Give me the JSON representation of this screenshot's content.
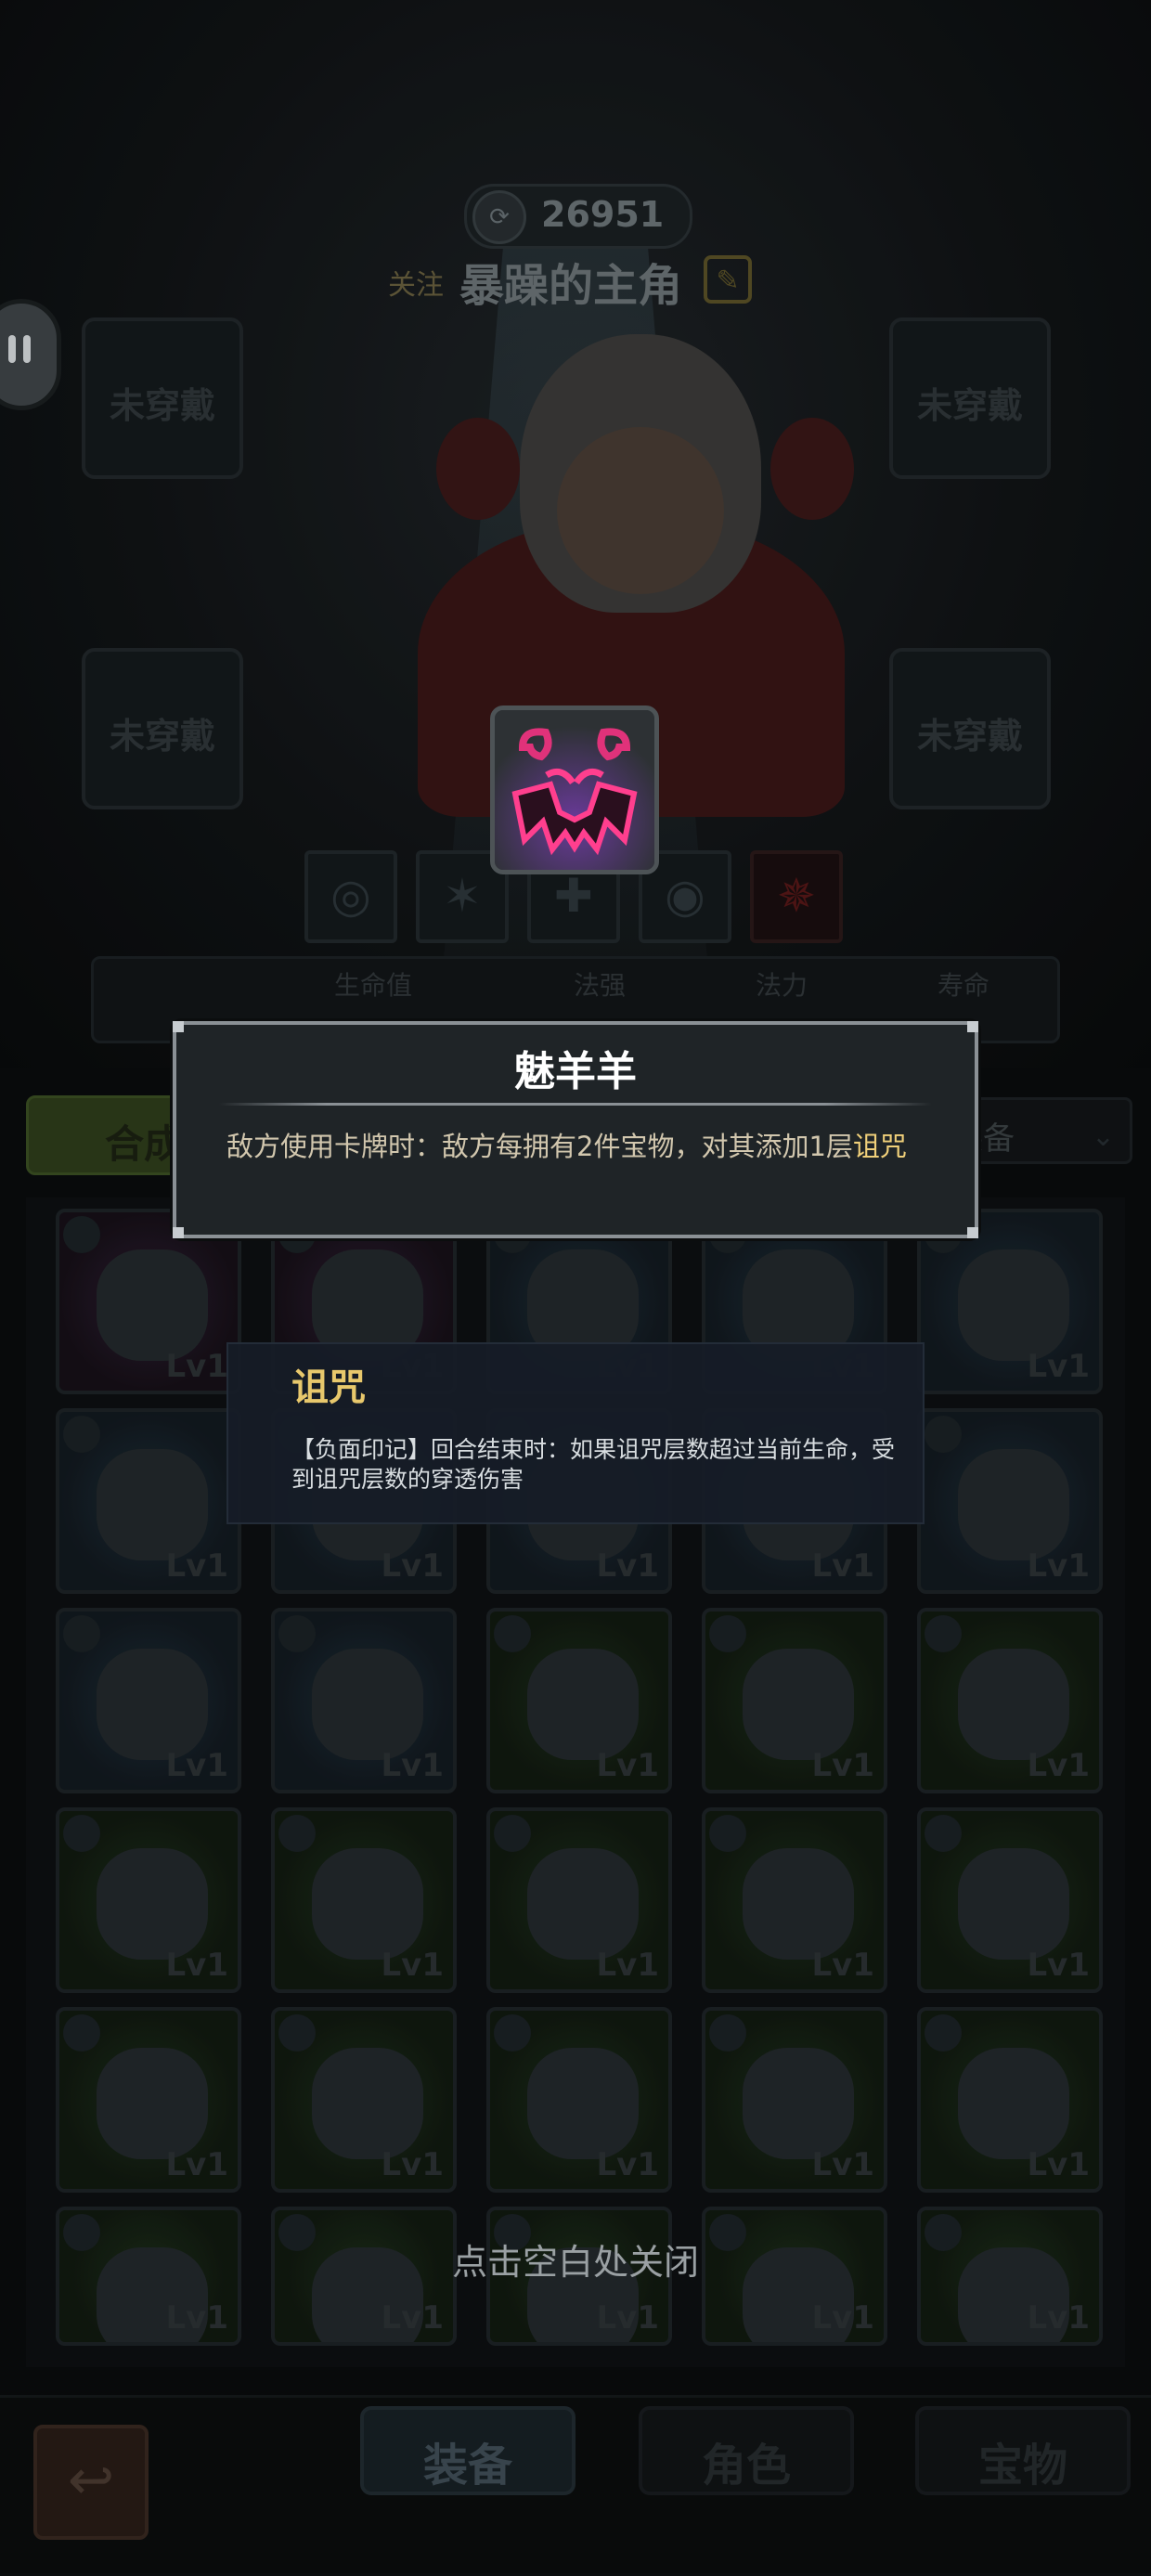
{
  "header": {
    "coins": "26951",
    "follow_label": "关注",
    "hero_name": "暴躁的主角"
  },
  "slots": {
    "empty_label": "未穿戴"
  },
  "toolbar": {
    "merge_label": "合成",
    "filter_label": "装备",
    "filter_icon": "chevron-down-icon"
  },
  "stats": {
    "hp_label": "生命值",
    "magic_label": "法强",
    "mana_label": "法力",
    "life_label": "寿命"
  },
  "tooltip": {
    "title": "魅羊羊",
    "desc_prefix": "敌方使用卡牌时：敌方每拥有2件宝物，对其添加1层",
    "desc_keyword": "诅咒"
  },
  "keyword_tip": {
    "title": "诅咒",
    "desc": "【负面印记】回合结束时：如果诅咒层数超过当前生命，受到诅咒层数的穿透伤害"
  },
  "inventory": {
    "level_label": "Lv1",
    "rows": [
      [
        "purple",
        "purple",
        "blue",
        "blue",
        "blue"
      ],
      [
        "blue",
        "blue",
        "blue",
        "blue",
        "blue"
      ],
      [
        "blue",
        "blue",
        "green",
        "green",
        "green"
      ],
      [
        "green",
        "green",
        "green",
        "green",
        "green"
      ],
      [
        "green",
        "green",
        "green",
        "green",
        "green"
      ],
      [
        "green",
        "green",
        "green",
        "green",
        "green"
      ]
    ]
  },
  "hint": "点击空白处关闭",
  "tabs": {
    "equip": "装备",
    "role": "角色",
    "treasure": "宝物"
  },
  "colors": {
    "title_white": "#ffffff",
    "keyword_gold": "#f0d07a",
    "curse_title": "#e8c86c",
    "card_glow": "#e0327a"
  }
}
